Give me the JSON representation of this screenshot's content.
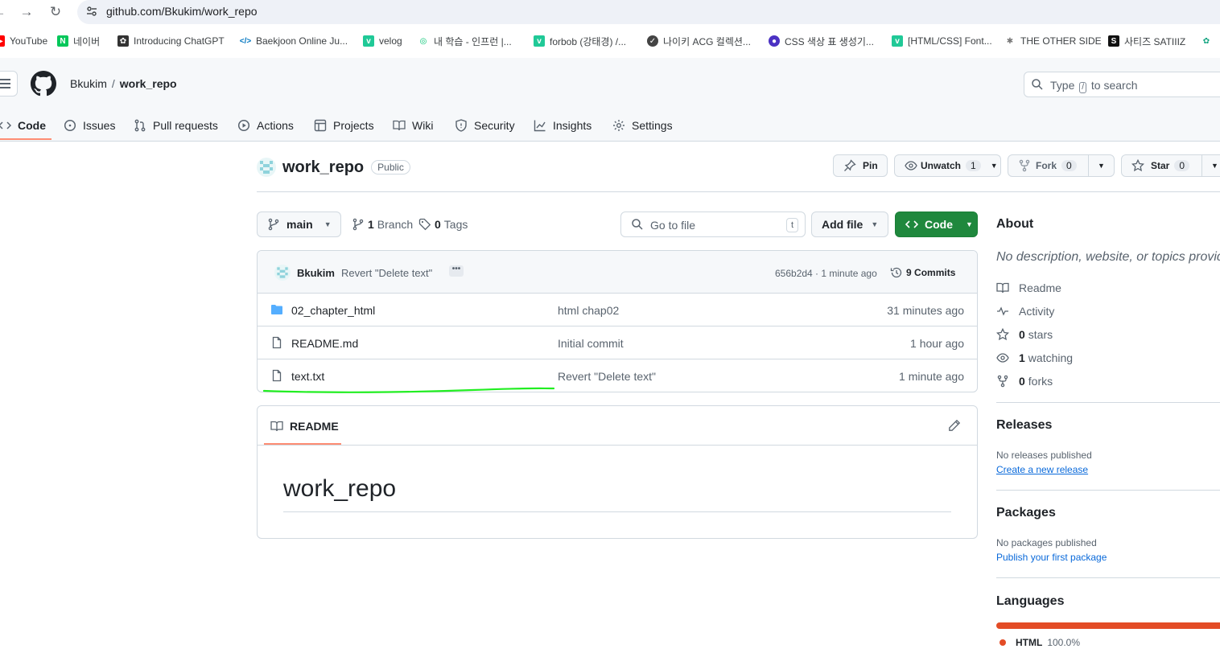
{
  "browser": {
    "url": "github.com/Bkukim/work_repo",
    "bookmarks": [
      {
        "label": "YouTube",
        "icon": "youtube-icon",
        "color": "#ff0000"
      },
      {
        "label": "네이버",
        "icon": "naver-icon",
        "color": "#03c75a"
      },
      {
        "label": "Introducing ChatGPT",
        "icon": "openai-icon",
        "color": "#333333"
      },
      {
        "label": "Baekjoon Online Ju...",
        "icon": "code-icon",
        "color": "#0076c0"
      },
      {
        "label": "velog",
        "icon": "velog-icon",
        "color": "#20c997"
      },
      {
        "label": "내 학습 - 인프런 |...",
        "icon": "inflearn-icon",
        "color": "#00c471"
      },
      {
        "label": "forbob (강태경) /...",
        "icon": "velog-icon",
        "color": "#20c997"
      },
      {
        "label": "나이키 ACG 컬렉션...",
        "icon": "nike-icon",
        "color": "#444444"
      },
      {
        "label": "CSS 색상 표 생성기...",
        "icon": "palette-icon",
        "color": "#4b32c3"
      },
      {
        "label": "[HTML/CSS] Font...",
        "icon": "velog-icon",
        "color": "#20c997"
      },
      {
        "label": "THE OTHER SIDE",
        "icon": "star-icon",
        "color": "#777777"
      },
      {
        "label": "사티즈 SATIIIZ",
        "icon": "satiiiz-icon",
        "color": "#111111"
      }
    ]
  },
  "header": {
    "owner": "Bkukim",
    "separator": "/",
    "repo": "work_repo",
    "search_prefix": "Type",
    "search_key": "/",
    "search_suffix": "to search"
  },
  "tabs": [
    {
      "label": "Code",
      "icon": "code-icon",
      "active": true
    },
    {
      "label": "Issues",
      "icon": "issue-icon"
    },
    {
      "label": "Pull requests",
      "icon": "pull-request-icon"
    },
    {
      "label": "Actions",
      "icon": "play-icon"
    },
    {
      "label": "Projects",
      "icon": "table-icon"
    },
    {
      "label": "Wiki",
      "icon": "book-icon"
    },
    {
      "label": "Security",
      "icon": "shield-icon"
    },
    {
      "label": "Insights",
      "icon": "graph-icon"
    },
    {
      "label": "Settings",
      "icon": "gear-icon"
    }
  ],
  "repo": {
    "name": "work_repo",
    "visibility": "Public",
    "pin_label": "Pin",
    "unwatch_label": "Unwatch",
    "watch_count": "1",
    "fork_label": "Fork",
    "fork_count": "0",
    "star_label": "Star",
    "star_count": "0"
  },
  "toolbar": {
    "branch": "main",
    "branch_count": "1",
    "branch_label": "Branch",
    "tag_count": "0",
    "tag_label": "Tags",
    "goto_placeholder": "Go to file",
    "goto_key": "t",
    "add_file": "Add file",
    "code_button": "Code"
  },
  "latest_commit": {
    "author": "Bkukim",
    "message": "Revert \"Delete text\"",
    "sha_time": "656b2d4 · 1 minute ago",
    "commits_count": "9",
    "commits_label": "Commits"
  },
  "files": [
    {
      "name": "02_chapter_html",
      "type": "folder",
      "message": "html chap02",
      "time": "31 minutes ago"
    },
    {
      "name": "README.md",
      "type": "file",
      "message": "Initial commit",
      "time": "1 hour ago"
    },
    {
      "name": "text.txt",
      "type": "file",
      "message": "Revert \"Delete text\"",
      "time": "1 minute ago"
    }
  ],
  "readme": {
    "tab_label": "README",
    "heading": "work_repo"
  },
  "sidebar": {
    "about_title": "About",
    "description": "No description, website, or topics provided.",
    "readme_label": "Readme",
    "activity_label": "Activity",
    "stars_count": "0",
    "stars_label": "stars",
    "watching_count": "1",
    "watching_label": "watching",
    "forks_count": "0",
    "forks_label": "forks",
    "releases_title": "Releases",
    "releases_empty": "No releases published",
    "releases_link": "Create a new release",
    "packages_title": "Packages",
    "packages_empty": "No packages published",
    "packages_link": "Publish your first package",
    "languages_title": "Languages",
    "language_name": "HTML",
    "language_percent": "100.0%",
    "language_color": "#e34c26"
  },
  "colors": {
    "accent_underline": "#fd8c73",
    "code_button": "#1f883d",
    "annotation_line": "#22ee22"
  }
}
